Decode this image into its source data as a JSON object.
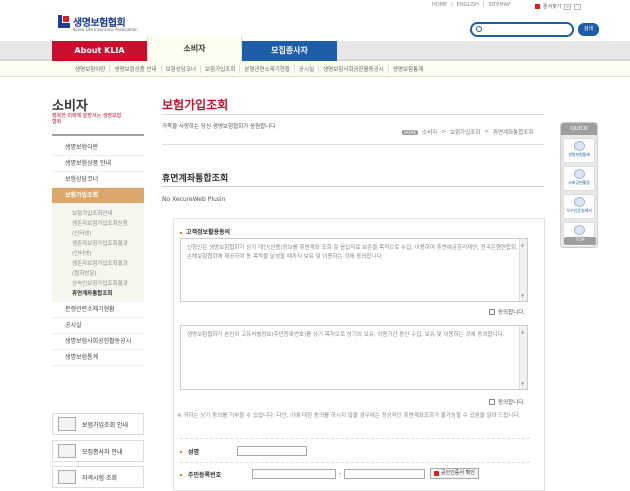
{
  "logo": {
    "name": "생명보험협회",
    "eng": "Korea Life Insurance Association"
  },
  "util_links": [
    "HOME",
    "ENGLISH",
    "SITEMAP"
  ],
  "bookmark": "즐겨찾기",
  "font_size": [
    "+",
    "-"
  ],
  "search": {
    "placeholder": "",
    "button": "검색"
  },
  "gnb": {
    "tabs": [
      "About KLIA",
      "소비자",
      "모집종사자"
    ]
  },
  "lnb": {
    "items": [
      "생명보험이란",
      "생명보험상품 안내",
      "보험상담코너",
      "보험가입조회",
      "분쟁관련소제기현황",
      "공시실",
      "생명보험사회공헌활동공시",
      "생명보험통계"
    ]
  },
  "sidebar": {
    "title": "소비자",
    "subtitle": "행복한 미래에 앞장서는 생명보험협회",
    "menu": [
      "생명보험이란",
      "생명보험상품 안내",
      "보험상담코너",
      "보험가입조회",
      "분쟁관련소제기현황",
      "공시실",
      "생명보험사회공헌활동공시",
      "생명보험통계"
    ],
    "submenu": [
      "보험가입조회안내",
      "생존자보험가입조회신청",
      "(인터넷)",
      "생존자보험가입조회결과",
      "(인터넷)",
      "생존자보험가입조회결과",
      "(협회방문)",
      "상속인보험가입조회결과",
      "휴면계좌통합조회"
    ],
    "banners": [
      "보험가입조회 안내",
      "모집종사자 안내",
      "자격시험 조회"
    ]
  },
  "main": {
    "title": "보험가입조회",
    "description": "가족을 사랑하는 당신 생명보험협회가 응원합니다",
    "breadcrumb": [
      "HOME",
      "소비자",
      "보험가입조회",
      "휴면계좌통합조회"
    ],
    "section_title": "휴면계좌통합조회",
    "plugin": "No XecureWeb Plusin",
    "consent_label": "고객정보활용동의",
    "consent1": "신청인은 생명보험협회가 상기 개인(신용)정보를 휴면계좌 조회 및 응답자료 보존을 목적으로 수집, 이용하여 휴면예금관리재단, 전국은행연합회, 손해보험협회에 제공하여 동 목적을 달성할 때까지 보유 및 이용하는 것에 동의합니다.",
    "agree1": "동의합니다.",
    "consent2": "생명보험협회가 본인의 고유식별정보(주민등록번호)를 상기 목적으로 상기의 보유, 이용기간 동안 수집, 보유 및 이용하는 것에 동의합니다.",
    "agree2": "동의합니다.",
    "note": "※ 귀하는 상기 동의를 거부할 수 있습니다. 다만, 이에 대한 동의를 하시지 않을 경우에는 정상적인 휴면계좌조회가 불가능할 수 있음을 알려 드립니다.",
    "name_label": "성명",
    "rrn_label": "주민등록번호",
    "rrn_sep": "-",
    "cert_button": "공인인증서 확인"
  },
  "quick": {
    "title": "QUICK",
    "items": [
      "생명보험통계",
      "사회공헌활동",
      "우수인증설계사",
      "시간선택제"
    ],
    "top": "TOP"
  }
}
